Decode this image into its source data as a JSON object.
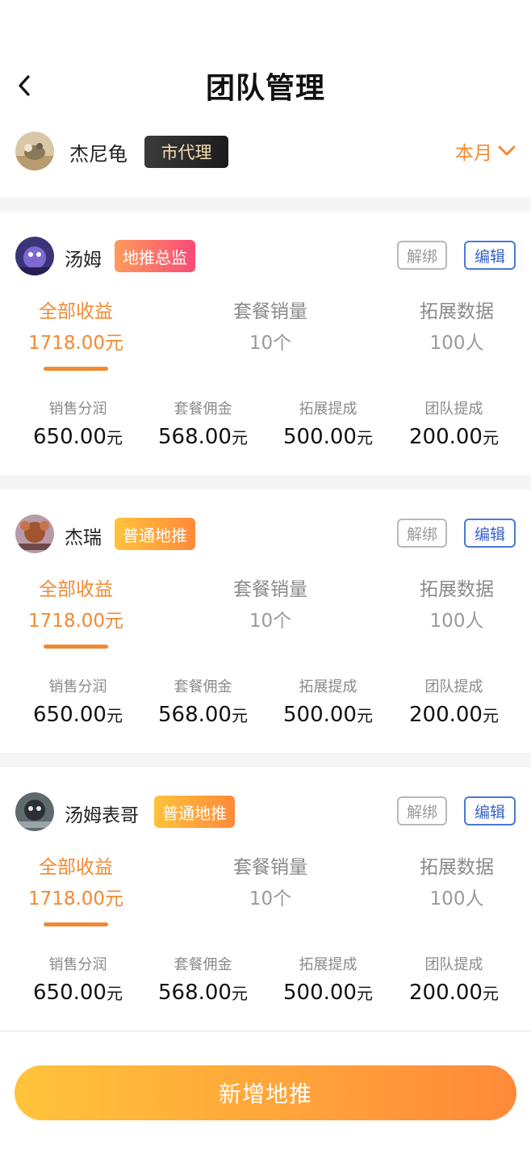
{
  "header": {
    "title": "团队管理",
    "back_icon": "chevron-left-icon"
  },
  "current_user": {
    "name": "杰尼龟",
    "role": "市代理",
    "period_label": "本月",
    "period_icon": "chevron-down-icon"
  },
  "members": [
    {
      "name": "汤姆",
      "role": "地推总监",
      "role_style": "red",
      "unbind_label": "解绑",
      "edit_label": "编辑",
      "tabs": [
        {
          "label": "全部收益",
          "value": "1718.00元",
          "active": true
        },
        {
          "label": "套餐销量",
          "value": "10个",
          "active": false
        },
        {
          "label": "拓展数据",
          "value": "100人",
          "active": false
        }
      ],
      "stats": [
        {
          "label": "销售分润",
          "amount": "650.00",
          "unit": "元"
        },
        {
          "label": "套餐佣金",
          "amount": "568.00",
          "unit": "元"
        },
        {
          "label": "拓展提成",
          "amount": "500.00",
          "unit": "元"
        },
        {
          "label": "团队提成",
          "amount": "200.00",
          "unit": "元"
        }
      ]
    },
    {
      "name": "杰瑞",
      "role": "普通地推",
      "role_style": "orange",
      "unbind_label": "解绑",
      "edit_label": "编辑",
      "tabs": [
        {
          "label": "全部收益",
          "value": "1718.00元",
          "active": true
        },
        {
          "label": "套餐销量",
          "value": "10个",
          "active": false
        },
        {
          "label": "拓展数据",
          "value": "100人",
          "active": false
        }
      ],
      "stats": [
        {
          "label": "销售分润",
          "amount": "650.00",
          "unit": "元"
        },
        {
          "label": "套餐佣金",
          "amount": "568.00",
          "unit": "元"
        },
        {
          "label": "拓展提成",
          "amount": "500.00",
          "unit": "元"
        },
        {
          "label": "团队提成",
          "amount": "200.00",
          "unit": "元"
        }
      ]
    },
    {
      "name": "汤姆表哥",
      "role": "普通地推",
      "role_style": "orange",
      "unbind_label": "解绑",
      "edit_label": "编辑",
      "tabs": [
        {
          "label": "全部收益",
          "value": "1718.00元",
          "active": true
        },
        {
          "label": "套餐销量",
          "value": "10个",
          "active": false
        },
        {
          "label": "拓展数据",
          "value": "100人",
          "active": false
        }
      ],
      "stats": [
        {
          "label": "销售分润",
          "amount": "650.00",
          "unit": "元"
        },
        {
          "label": "套餐佣金",
          "amount": "568.00",
          "unit": "元"
        },
        {
          "label": "拓展提成",
          "amount": "500.00",
          "unit": "元"
        },
        {
          "label": "团队提成",
          "amount": "200.00",
          "unit": "元"
        }
      ]
    }
  ],
  "footer": {
    "add_label": "新增地推"
  },
  "colors": {
    "accent": "#f08a33",
    "edit_blue": "#3763c9",
    "badge_dark": "#1c1c1c"
  }
}
